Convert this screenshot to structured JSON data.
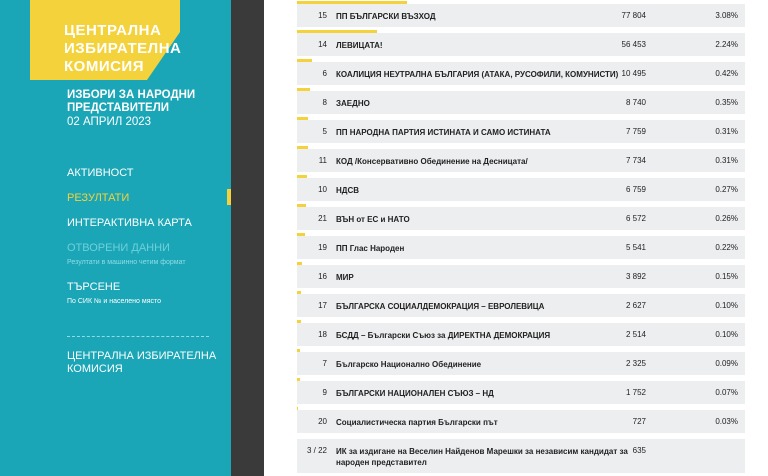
{
  "sidebar": {
    "logo": [
      "ЦЕНТРАЛНА",
      "ИЗБИРАТЕЛНА",
      "КОМИСИЯ"
    ],
    "election_title": "ИЗБОРИ ЗА НАРОДНИ ПРЕДСТАВИТЕЛИ",
    "election_date": "02 АПРИЛ 2023",
    "nav": [
      {
        "label": "АКТИВНОСТ"
      },
      {
        "label": "РЕЗУЛТАТИ"
      },
      {
        "label": "ИНТЕРАКТИВНА КАРТА"
      },
      {
        "label": "ОТВОРЕНИ ДАННИ",
        "sub": "Резултати в машинно четим формат"
      },
      {
        "label": "ТЪРСЕНЕ",
        "sub": "По СИК № и населено място"
      }
    ],
    "cik_name": "ЦЕНТРАЛНА ИЗБИРАТЕЛНА КОМИСИЯ"
  },
  "results": [
    {
      "num": "15",
      "name": "ПП БЪЛГАРСКИ ВЪЗХОД",
      "votes": "77 804",
      "pct": "3.08%",
      "share": 3.08
    },
    {
      "num": "14",
      "name": "ЛЕВИЦАТА!",
      "votes": "56 453",
      "pct": "2.24%",
      "share": 2.24
    },
    {
      "num": "6",
      "name": "КОАЛИЦИЯ НЕУТРАЛНА БЪЛГАРИЯ (АТАКА, РУСОФИЛИ, КОМУНИСТИ)",
      "votes": "10 495",
      "pct": "0.42%",
      "share": 0.42
    },
    {
      "num": "8",
      "name": "ЗАЕДНО",
      "votes": "8 740",
      "pct": "0.35%",
      "share": 0.35
    },
    {
      "num": "5",
      "name": "ПП НАРОДНА ПАРТИЯ ИСТИНАТА И САМО ИСТИНАТА",
      "votes": "7 759",
      "pct": "0.31%",
      "share": 0.31
    },
    {
      "num": "11",
      "name": "КОД /Консервативно Обединение на Десницата/",
      "votes": "7 734",
      "pct": "0.31%",
      "share": 0.31
    },
    {
      "num": "10",
      "name": "НДСВ",
      "votes": "6 759",
      "pct": "0.27%",
      "share": 0.27
    },
    {
      "num": "21",
      "name": "ВЪН от ЕС и НАТО",
      "votes": "6 572",
      "pct": "0.26%",
      "share": 0.26
    },
    {
      "num": "19",
      "name": "ПП Глас Народен",
      "votes": "5 541",
      "pct": "0.22%",
      "share": 0.22
    },
    {
      "num": "16",
      "name": "МИР",
      "votes": "3 892",
      "pct": "0.15%",
      "share": 0.15
    },
    {
      "num": "17",
      "name": "БЪЛГАРСКА СОЦИАЛДЕМОКРАЦИЯ – ЕВРОЛЕВИЦА",
      "votes": "2 627",
      "pct": "0.10%",
      "share": 0.1
    },
    {
      "num": "18",
      "name": "БСДД – Български Съюз за ДИРЕКТНА ДЕМОКРАЦИЯ",
      "votes": "2 514",
      "pct": "0.10%",
      "share": 0.1
    },
    {
      "num": "7",
      "name": "Българско Национално Обединение",
      "votes": "2 325",
      "pct": "0.09%",
      "share": 0.09
    },
    {
      "num": "9",
      "name": "БЪЛГАРСКИ НАЦИОНАЛЕН СЪЮЗ – НД",
      "votes": "1 752",
      "pct": "0.07%",
      "share": 0.07
    },
    {
      "num": "20",
      "name": "Социалистическа партия Български път",
      "votes": "727",
      "pct": "0.03%",
      "share": 0.03
    },
    {
      "num": "3 / 22",
      "name": "ИК за издигане на Веселин Найденов Марешки за независим кандидат за народен представител",
      "votes": "635",
      "pct": "",
      "share": 0
    }
  ],
  "colors": {
    "sidebar": "#1aa6b7",
    "accent": "#f4d23c",
    "row": "#eceef0",
    "strip": "#3a3a3a"
  }
}
